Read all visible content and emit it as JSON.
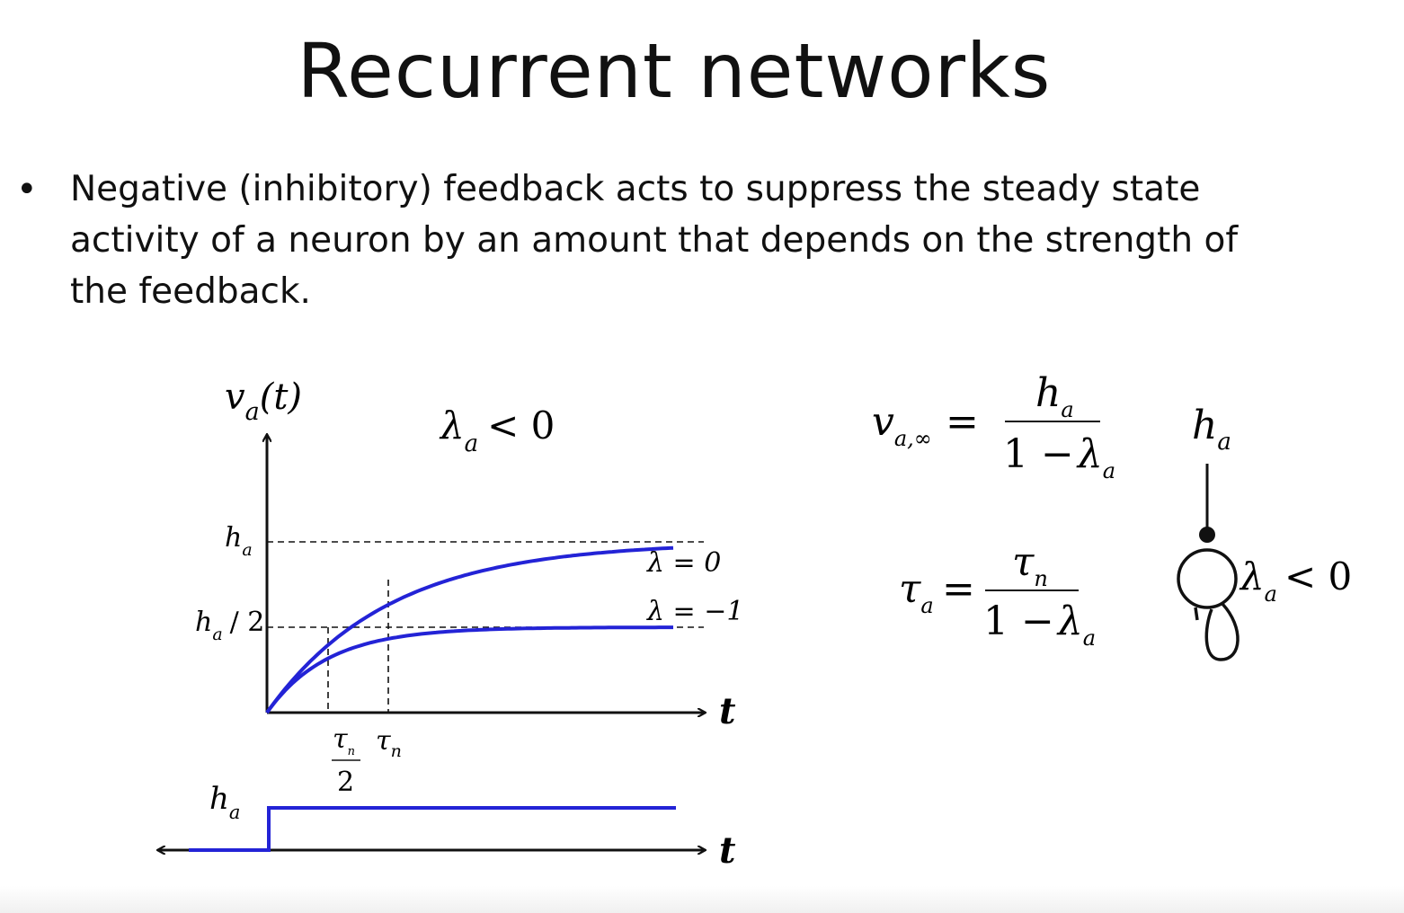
{
  "slide": {
    "title": "Recurrent networks",
    "bullet": "Negative (inhibitory) feedback acts to suppress the steady state activity of a neuron by an amount that depends on the strength of the feedback."
  },
  "graph": {
    "y_axis_label": {
      "v": "v",
      "sub": "a",
      "arg": "(t)"
    },
    "condition": {
      "lambda": "λ",
      "sub": "a",
      "rel": "< 0"
    },
    "level_high": {
      "h": "h",
      "sub": "a"
    },
    "level_half": {
      "h": "h",
      "sub": "a",
      "rest": "/ 2"
    },
    "curve_top_label": "λ = 0",
    "curve_bottom_label": "λ = −1",
    "x_axis_label": "t",
    "tick_tau_half": {
      "tau": "τ",
      "sub": "n",
      "den": "2"
    },
    "tick_tau": {
      "tau": "τ",
      "sub": "n"
    },
    "curve_color": "#2323d6"
  },
  "input_graph": {
    "label": {
      "h": "h",
      "sub": "a"
    },
    "x_axis_label": "t"
  },
  "equations": {
    "steady_state": {
      "lhs_v": "v",
      "lhs_sub": "a,∞",
      "eq": "=",
      "num_h": "h",
      "num_sub": "a",
      "den_one_minus": "1 −",
      "den_lambda": "λ",
      "den_sub": "a"
    },
    "time_constant": {
      "lhs_tau": "τ",
      "lhs_sub": "a",
      "eq": "=",
      "num_tau": "τ",
      "num_sub": "n",
      "den_one_minus": "1 −",
      "den_lambda": "λ",
      "den_sub": "a"
    }
  },
  "neuron_diagram": {
    "input": {
      "h": "h",
      "sub": "a"
    },
    "feedback": {
      "lambda": "λ",
      "sub": "a",
      "rel": "< 0"
    }
  }
}
